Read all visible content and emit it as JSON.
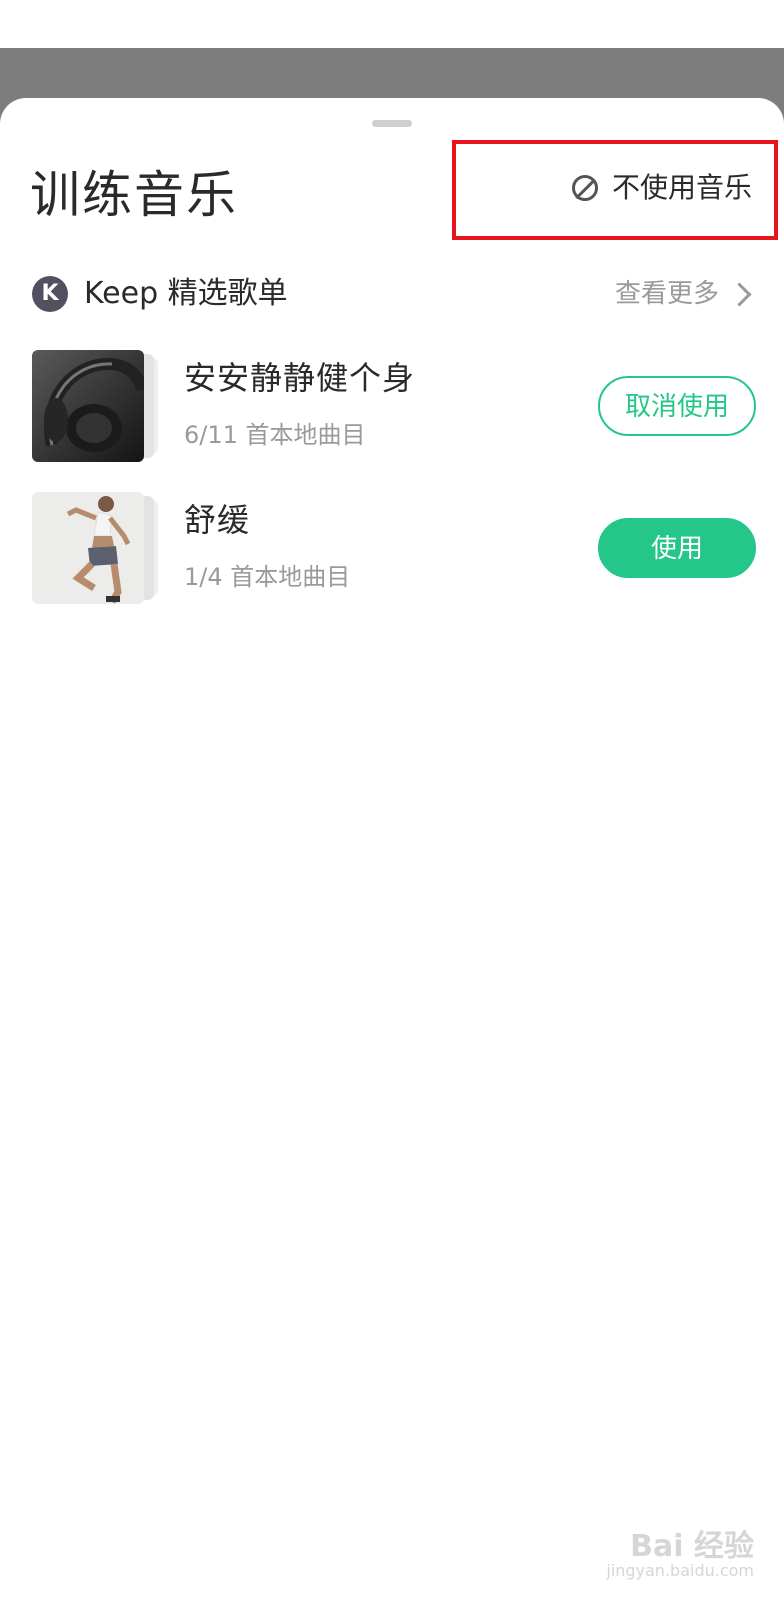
{
  "sheet": {
    "title": "训练音乐",
    "no_music_label": "不使用音乐",
    "no_music_icon": "ban-icon"
  },
  "section": {
    "label": "Keep 精选歌单",
    "logo_letter": "K",
    "more_label": "查看更多",
    "more_icon": "chevron-right-icon"
  },
  "playlists": [
    {
      "title": "安安静静健个身",
      "subtitle": "6/11 首本地曲目",
      "button_label": "取消使用",
      "button_style": "outline",
      "cover_icon": "headphones-cover"
    },
    {
      "title": "舒缓",
      "subtitle": "1/4 首本地曲目",
      "button_label": "使用",
      "button_style": "filled",
      "cover_icon": "runner-cover"
    }
  ],
  "watermark": {
    "text": "Bai 经验",
    "url": "jingyan.baidu.com"
  },
  "colors": {
    "accent": "#24c789",
    "highlight_border": "#e8141b",
    "scrim": "#7d7d7d"
  }
}
